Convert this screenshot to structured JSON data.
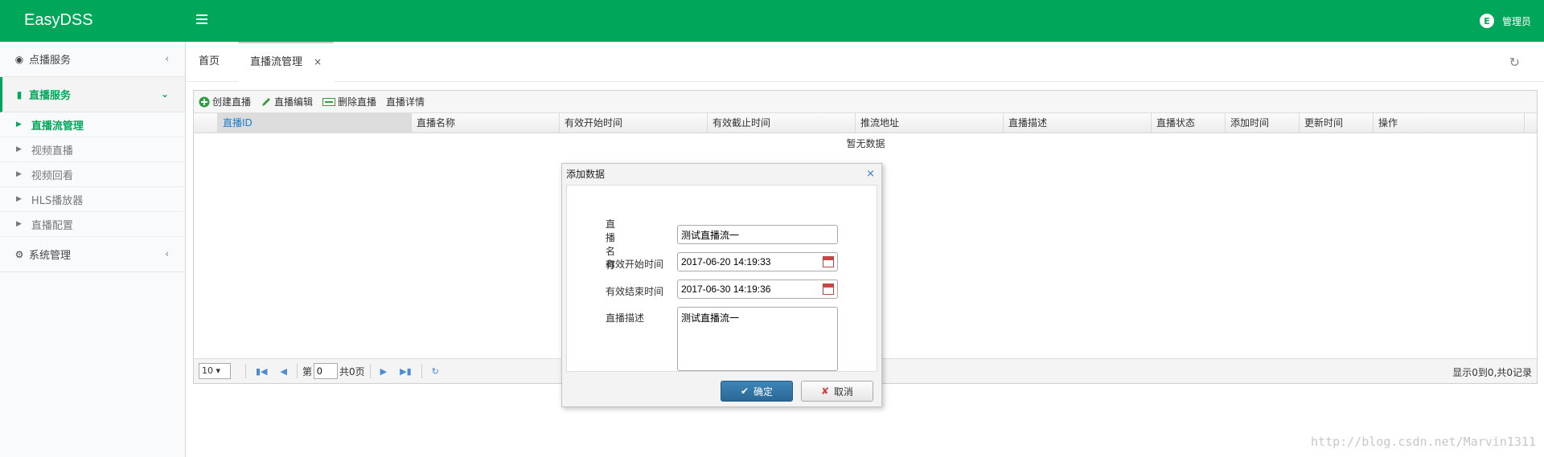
{
  "app": {
    "brand": "EasyDSS",
    "user_label": "管理员",
    "user_logo_letter": "E"
  },
  "sidebar": {
    "groups": [
      {
        "label": "点播服务",
        "icon": "play-circle-icon",
        "arrow": "‹"
      },
      {
        "label": "直播服务",
        "icon": "video-camera-icon",
        "arrow": "⌄"
      },
      {
        "label": "系统管理",
        "icon": "gear-icon",
        "arrow": "‹"
      }
    ],
    "sub_items": [
      {
        "label": "直播流管理"
      },
      {
        "label": "视频直播"
      },
      {
        "label": "视频回看"
      },
      {
        "label": "HLS播放器"
      },
      {
        "label": "直播配置"
      }
    ]
  },
  "tabs": [
    {
      "label": "首页"
    },
    {
      "label": "直播流管理",
      "close": "×"
    }
  ],
  "toolbar": {
    "create": "创建直播",
    "edit": "直播编辑",
    "delete": "删除直播",
    "detail": "直播详情"
  },
  "grid": {
    "columns": [
      "直播ID",
      "直播名称",
      "有效开始时间",
      "有效截止时间",
      "推流地址",
      "直播描述",
      "直播状态",
      "添加时间",
      "更新时间",
      "操作"
    ],
    "empty_text": "暂无数据"
  },
  "pager": {
    "page_size": "10 ▾",
    "page_prefix": "第",
    "page_value": "0",
    "page_total": "共0页",
    "info": "显示0到0,共0记录"
  },
  "dialog": {
    "title": "添加数据",
    "close": "×",
    "fields": [
      {
        "label": "直播名称",
        "value": "测试直播流一"
      },
      {
        "label": "有效开始时间",
        "value": "2017-06-20 14:19:33"
      },
      {
        "label": "有效结束时间",
        "value": "2017-06-30 14:19:36"
      },
      {
        "label": "直播描述",
        "value": "测试直播流一"
      }
    ],
    "ok_label": "确定",
    "cancel_label": "取消"
  },
  "watermark": "http://blog.csdn.net/Marvin1311",
  "colors": {
    "brand_green": "#00a65a",
    "link_blue": "#1a7bc9",
    "ok_button": "#2a6796"
  }
}
